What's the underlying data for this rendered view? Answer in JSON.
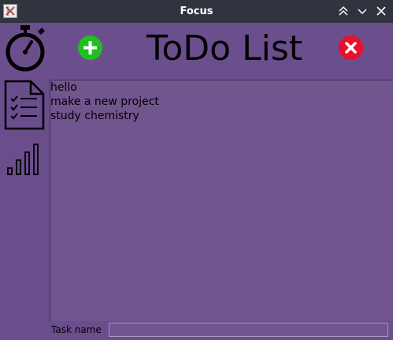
{
  "window": {
    "title": "Focus",
    "controls": [
      "maximize",
      "minimize",
      "close"
    ]
  },
  "header": {
    "title": "ToDo List",
    "add_icon": "plus-circle-icon",
    "close_icon": "x-circle-icon",
    "timer_icon": "stopwatch-icon"
  },
  "sidebar": {
    "items": [
      {
        "icon": "checklist-icon",
        "name": "tasks"
      },
      {
        "icon": "bar-chart-icon",
        "name": "stats"
      }
    ]
  },
  "tasks": {
    "items": [
      "hello",
      "make a new project",
      "study chemistry"
    ]
  },
  "input": {
    "label": "Task name",
    "value": ""
  },
  "colors": {
    "background": "#6a4e8c",
    "list_background": "#71558f",
    "titlebar": "#2f343f",
    "add_green": "#1fbf1f",
    "close_red": "#e8102a"
  }
}
